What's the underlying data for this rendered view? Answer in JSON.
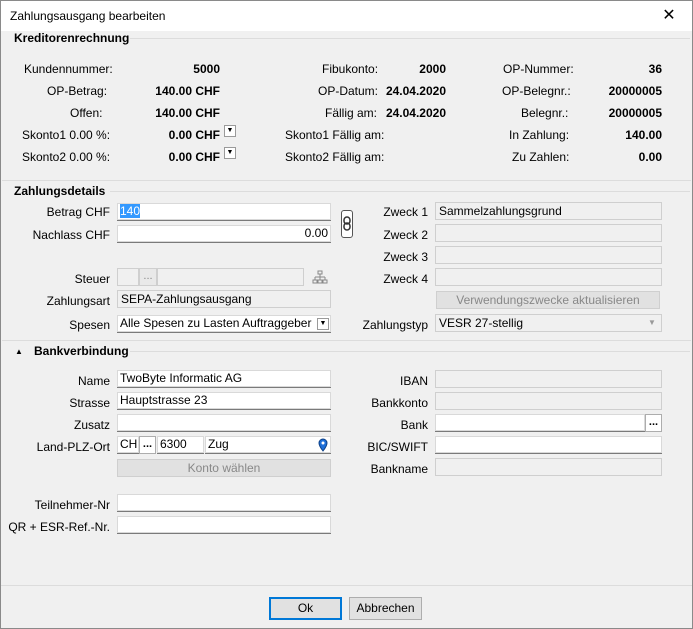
{
  "window": {
    "title": "Zahlungsausgang bearbeiten"
  },
  "kreditoren": {
    "heading": "Kreditorenrechnung",
    "kundennummer_label": "Kundennummer:",
    "kundennummer": "5000",
    "op_betrag_label": "OP-Betrag:",
    "op_betrag": "140.00 CHF",
    "offen_label": "Offen:",
    "offen": "140.00 CHF",
    "skonto1_label": "Skonto1 0.00 %:",
    "skonto1": "0.00 CHF",
    "skonto2_label": "Skonto2 0.00 %:",
    "skonto2": "0.00 CHF",
    "fibukonto_label": "Fibukonto:",
    "fibukonto": "2000",
    "op_datum_label": "OP-Datum:",
    "op_datum": "24.04.2020",
    "faellig_label": "Fällig am:",
    "faellig": "24.04.2020",
    "skonto1_faellig_label": "Skonto1 Fällig am:",
    "skonto2_faellig_label": "Skonto2 Fällig am:",
    "op_nummer_label": "OP-Nummer:",
    "op_nummer": "36",
    "op_belegnr_label": "OP-Belegnr.:",
    "op_belegnr": "20000005",
    "belegnr_label": "Belegnr.:",
    "belegnr": "20000005",
    "in_zahlung_label": "In Zahlung:",
    "in_zahlung": "140.00",
    "zu_zahlen_label": "Zu Zahlen:",
    "zu_zahlen": "0.00"
  },
  "zahlung": {
    "heading": "Zahlungsdetails",
    "betrag_label": "Betrag CHF",
    "betrag": "140",
    "nachlass_label": "Nachlass CHF",
    "nachlass": "0.00",
    "steuer_label": "Steuer",
    "steuer": "",
    "zahlungsart_label": "Zahlungsart",
    "zahlungsart": "SEPA-Zahlungsausgang",
    "spesen_label": "Spesen",
    "spesen": "Alle Spesen zu Lasten Auftraggeber",
    "zweck1_label": "Zweck 1",
    "zweck1": "Sammelzahlungsgrund",
    "zweck2_label": "Zweck 2",
    "zweck2": "",
    "zweck3_label": "Zweck 3",
    "zweck3": "",
    "zweck4_label": "Zweck 4",
    "zweck4": "",
    "update_button": "Verwendungszwecke aktualisieren",
    "zahlungstyp_label": "Zahlungstyp",
    "zahlungstyp": "VESR 27-stellig",
    "ellipsis": "..."
  },
  "bank": {
    "heading": "Bankverbindung",
    "name_label": "Name",
    "name": "TwoByte Informatic AG",
    "strasse_label": "Strasse",
    "strasse": "Hauptstrasse 23",
    "zusatz_label": "Zusatz",
    "zusatz": "",
    "land_label": "Land-PLZ-Ort",
    "land": "CH",
    "plz": "6300",
    "ort": "Zug",
    "konto_button": "Konto wählen",
    "teilnehmer_label": "Teilnehmer-Nr",
    "teilnehmer": "",
    "qr_label": "QR + ESR-Ref.-Nr.",
    "qr": "",
    "iban_label": "IBAN",
    "iban": "",
    "bankkonto_label": "Bankkonto",
    "bankkonto": "",
    "bank_label": "Bank",
    "bank": "",
    "bic_label": "BIC/SWIFT",
    "bic": "",
    "bankname_label": "Bankname",
    "bankname": ""
  },
  "footer": {
    "ok": "Ok",
    "cancel": "Abbrechen"
  }
}
